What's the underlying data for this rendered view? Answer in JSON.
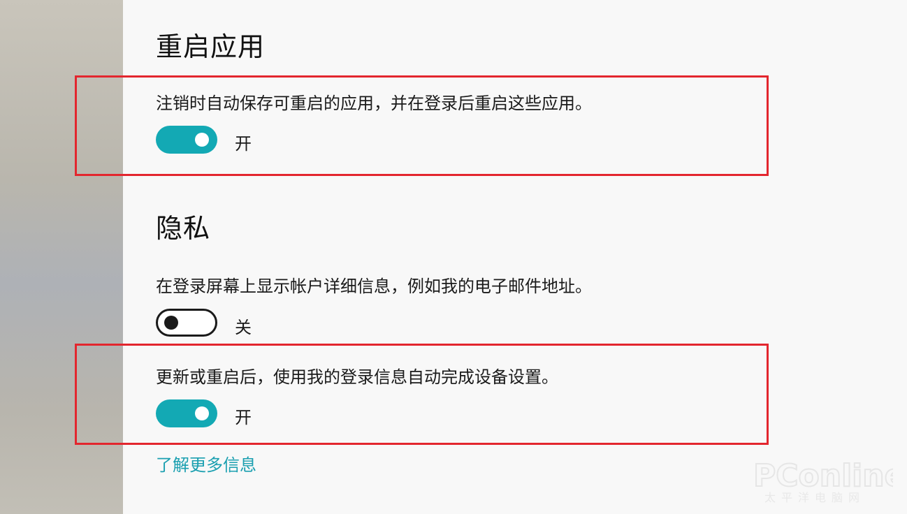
{
  "restart_apps": {
    "title": "重启应用",
    "description": "注销时自动保存可重启的应用，并在登录后重启这些应用。",
    "toggle_state": "开"
  },
  "privacy": {
    "title": "隐私",
    "show_account_details": {
      "description": "在登录屏幕上显示帐户详细信息，例如我的电子邮件地址。",
      "toggle_state": "关"
    },
    "auto_finish_setup": {
      "description": "更新或重启后，使用我的登录信息自动完成设备设置。",
      "toggle_state": "开"
    },
    "learn_more": "了解更多信息"
  },
  "watermark": {
    "brand": "PConline",
    "tagline": "太平洋电脑网"
  },
  "colors": {
    "toggle_on": "#13a9b4",
    "highlight_border": "#e3262e",
    "link": "#1a9fb0"
  }
}
